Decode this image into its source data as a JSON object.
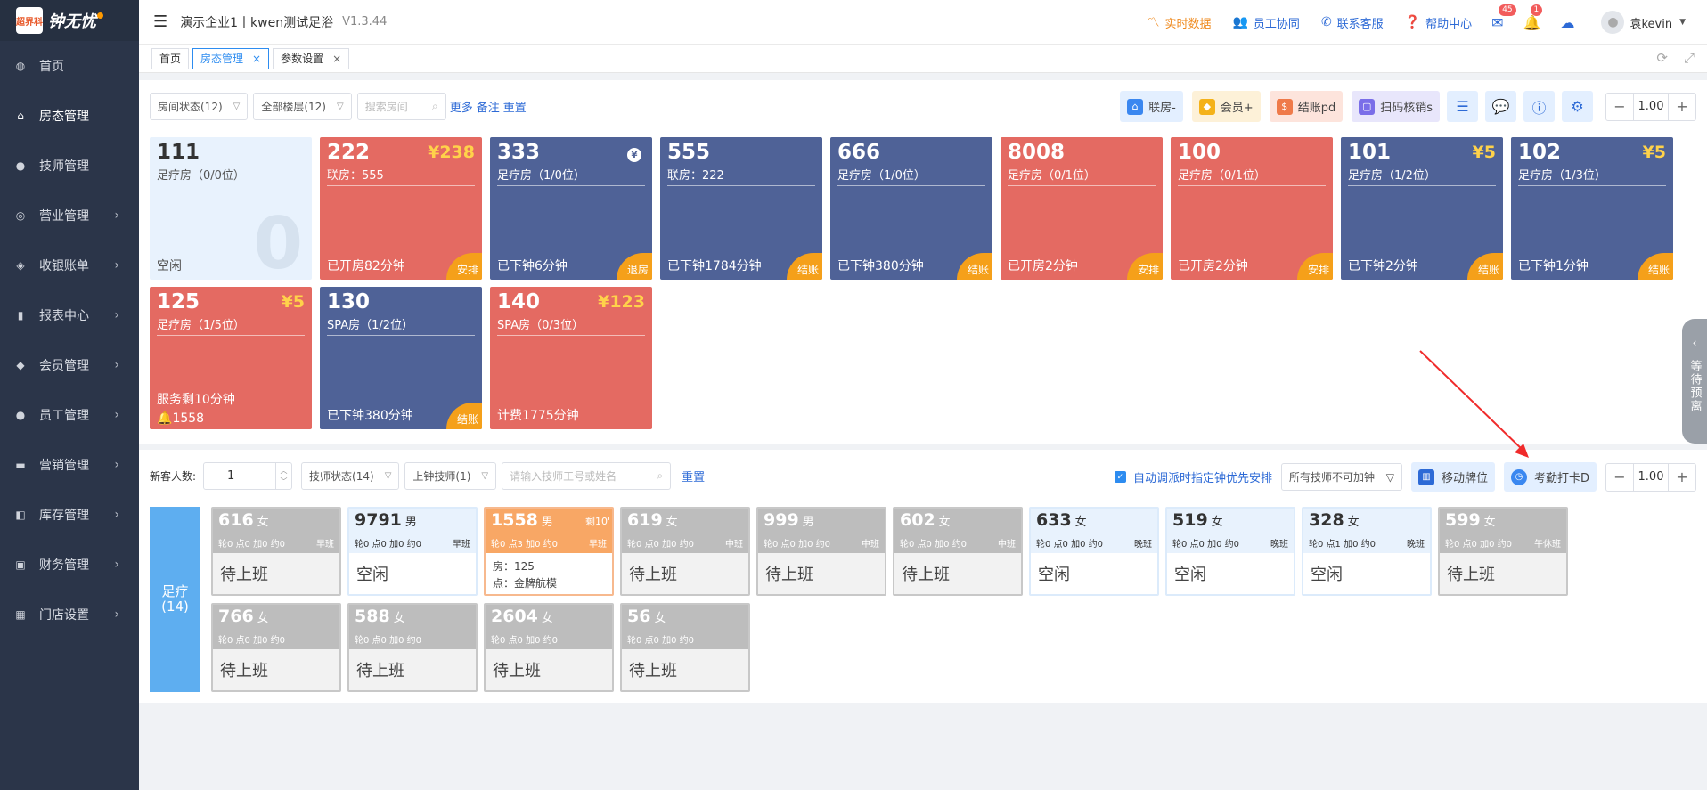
{
  "app": {
    "logo_label": "钟无忧",
    "logo_small": "超界科"
  },
  "sidebar": {
    "items": [
      {
        "label": "首页",
        "icon": "dashboard-icon",
        "glyph": "◍",
        "arrow": false
      },
      {
        "label": "房态管理",
        "icon": "home-icon",
        "glyph": "⌂",
        "arrow": false,
        "active": true
      },
      {
        "label": "技师管理",
        "icon": "person-icon",
        "glyph": "●",
        "arrow": false
      },
      {
        "label": "营业管理",
        "icon": "target-icon",
        "glyph": "◎",
        "arrow": true
      },
      {
        "label": "收银账单",
        "icon": "money-bag-icon",
        "glyph": "◈",
        "arrow": true
      },
      {
        "label": "报表中心",
        "icon": "bar-chart-icon",
        "glyph": "▮",
        "arrow": true
      },
      {
        "label": "会员管理",
        "icon": "diamond-icon",
        "glyph": "◆",
        "arrow": true
      },
      {
        "label": "员工管理",
        "icon": "person-icon",
        "glyph": "●",
        "arrow": true
      },
      {
        "label": "营销管理",
        "icon": "briefcase-icon",
        "glyph": "▬",
        "arrow": true
      },
      {
        "label": "库存管理",
        "icon": "box-icon",
        "glyph": "◧",
        "arrow": true
      },
      {
        "label": "财务管理",
        "icon": "wallet-icon",
        "glyph": "▣",
        "arrow": true
      },
      {
        "label": "门店设置",
        "icon": "grid-icon",
        "glyph": "▦",
        "arrow": true
      }
    ]
  },
  "topbar": {
    "store": "演示企业1丨kwen测试足浴",
    "version": "V1.3.44",
    "actions": {
      "realtime": "实时数据",
      "staff": "员工协同",
      "contact": "联系客服",
      "help": "帮助中心"
    },
    "mail_badge": "45",
    "bell_badge": "1",
    "username": "袁kevin"
  },
  "tabs": [
    {
      "label": "首页",
      "closable": false
    },
    {
      "label": "房态管理",
      "closable": true,
      "active": true
    },
    {
      "label": "参数设置",
      "closable": true
    }
  ],
  "room_panel": {
    "filter_status": "房间状态(12)",
    "filter_floor": "全部楼层(12)",
    "search_placeholder": "搜索房间",
    "link_more": "更多",
    "link_note": "备注",
    "link_reset": "重置",
    "btn_link_room": "联房-",
    "btn_member": "会员+",
    "btn_checkout": "结账pd",
    "btn_scan": "扫码核销s",
    "zoom": "1.00"
  },
  "rooms": [
    {
      "num": "111",
      "type": "足疗房（0/0位）",
      "status": "空闲",
      "color": "idle",
      "big": "0"
    },
    {
      "num": "222",
      "price": "¥238",
      "type": "联房：555",
      "status": "已开房82分钟",
      "color": "red",
      "tag": "安排"
    },
    {
      "num": "333",
      "coin": "¥",
      "type": "足疗房（1/0位）",
      "status": "已下钟6分钟",
      "color": "blue",
      "tag": "退房"
    },
    {
      "num": "555",
      "type": "联房：222",
      "status": "已下钟1784分钟",
      "color": "blue",
      "tag": "结账"
    },
    {
      "num": "666",
      "type": "足疗房（1/0位）",
      "status": "已下钟380分钟",
      "color": "blue",
      "tag": "结账"
    },
    {
      "num": "8008",
      "type": "足疗房（0/1位）",
      "status": "已开房2分钟",
      "color": "red",
      "tag": "安排"
    },
    {
      "num": "100",
      "type": "足疗房（0/1位）",
      "status": "已开房2分钟",
      "color": "red",
      "tag": "安排"
    },
    {
      "num": "101",
      "price": "¥5",
      "type": "足疗房（1/2位）",
      "status": "已下钟2分钟",
      "color": "blue",
      "tag": "结账"
    },
    {
      "num": "102",
      "price": "¥5",
      "type": "足疗房（1/3位）",
      "status": "已下钟1分钟",
      "color": "blue",
      "tag": "结账"
    },
    {
      "num": "125",
      "price": "¥5",
      "type": "足疗房（1/5位）",
      "status": "服务剩10分钟",
      "bell": "1558",
      "color": "red"
    },
    {
      "num": "130",
      "type": "SPA房（1/2位）",
      "status": "已下钟380分钟",
      "color": "blue",
      "tag": "结账"
    },
    {
      "num": "140",
      "price": "¥123",
      "type": "SPA房（0/3位）",
      "status": "计费1775分钟",
      "color": "red"
    }
  ],
  "side_float": {
    "label": "等待预离"
  },
  "tech_panel": {
    "new_guest_label": "新客人数:",
    "new_guest_value": "1",
    "filter_status": "技师状态(14)",
    "filter_onduty": "上钟技师(1)",
    "search_placeholder": "请输入技师工号或姓名",
    "link_reset": "重置",
    "auto_dispatch_label": "自动调派时指定钟优先安排",
    "overtime_select": "所有技师不可加钟",
    "btn_move": "移动牌位",
    "btn_attendance": "考勤打卡D",
    "zoom": "1.00",
    "group_name": "足疗",
    "group_count": "(14)"
  },
  "techs": [
    {
      "num": "616",
      "gender": "女",
      "counts": "轮0 点0 加0 约0",
      "shift": "早班",
      "status": "待上班",
      "state": "off"
    },
    {
      "num": "9791",
      "gender": "男",
      "counts": "轮0 点0 加0 约0",
      "shift": "早班",
      "status": "空闲",
      "state": "idle"
    },
    {
      "num": "1558",
      "gender": "男",
      "remain": "剩10'",
      "counts": "轮0 点3 加0 约0",
      "shift": "早班",
      "room": "房：125",
      "item": "点：金牌航模",
      "state": "busy"
    },
    {
      "num": "619",
      "gender": "女",
      "counts": "轮0 点0 加0 约0",
      "shift": "中班",
      "status": "待上班",
      "state": "off"
    },
    {
      "num": "999",
      "gender": "男",
      "counts": "轮0 点0 加0 约0",
      "shift": "中班",
      "status": "待上班",
      "state": "off"
    },
    {
      "num": "602",
      "gender": "女",
      "counts": "轮0 点0 加0 约0",
      "shift": "中班",
      "status": "待上班",
      "state": "off"
    },
    {
      "num": "633",
      "gender": "女",
      "counts": "轮0 点0 加0 约0",
      "shift": "晚班",
      "status": "空闲",
      "state": "idle"
    },
    {
      "num": "519",
      "gender": "女",
      "counts": "轮0 点0 加0 约0",
      "shift": "晚班",
      "status": "空闲",
      "state": "idle"
    },
    {
      "num": "328",
      "gender": "女",
      "counts": "轮0 点1 加0 约0",
      "shift": "晚班",
      "status": "空闲",
      "state": "idle"
    },
    {
      "num": "599",
      "gender": "女",
      "counts": "轮0 点0 加0 约0",
      "shift": "午休班",
      "status": "待上班",
      "state": "off"
    },
    {
      "num": "766",
      "gender": "女",
      "counts": "轮0 点0 加0 约0",
      "shift": "",
      "status": "待上班",
      "state": "off"
    },
    {
      "num": "588",
      "gender": "女",
      "counts": "轮0 点0 加0 约0",
      "shift": "",
      "status": "待上班",
      "state": "off"
    },
    {
      "num": "2604",
      "gender": "女",
      "counts": "轮0 点0 加0 约0",
      "shift": "",
      "status": "待上班",
      "state": "off"
    },
    {
      "num": "56",
      "gender": "女",
      "counts": "轮0 点0 加0 约0",
      "shift": "",
      "status": "待上班",
      "state": "off"
    }
  ],
  "colors": {
    "sidebar": "#2b3549",
    "room_blue": "#4f6297",
    "room_red": "#e46a62",
    "tag_orange": "#f5a01a",
    "link": "#2d6ad6"
  }
}
